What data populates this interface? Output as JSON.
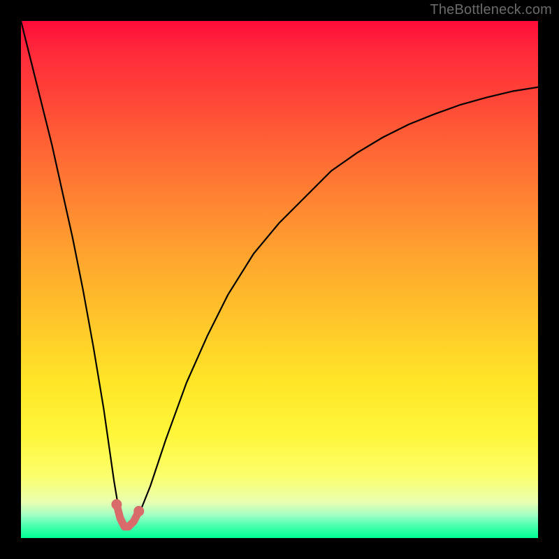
{
  "watermark": "TheBottleneck.com",
  "colors": {
    "frame": "#000000",
    "curve": "#000000",
    "highlight": "#d96b6b"
  },
  "chart_data": {
    "type": "line",
    "title": "",
    "xlabel": "",
    "ylabel": "",
    "xlim": [
      0,
      100
    ],
    "ylim": [
      0,
      100
    ],
    "grid": false,
    "legend": false,
    "description": "Bottleneck-style V-curve: value drops sharply to near zero around x≈20 then rises asymptotically toward the top-right. Background encodes value via gradient (red high → green low). A short pink/red arc highlights the minimum.",
    "series": [
      {
        "name": "bottleneck-curve",
        "x": [
          0,
          2,
          4,
          6,
          8,
          10,
          12,
          14,
          16,
          18,
          19,
          20,
          21,
          22,
          23,
          25,
          28,
          32,
          36,
          40,
          45,
          50,
          55,
          60,
          65,
          70,
          75,
          80,
          85,
          90,
          95,
          100
        ],
        "values": [
          100,
          92,
          84,
          76,
          67,
          58,
          48,
          37,
          25,
          11,
          5,
          2,
          2,
          3,
          5,
          10,
          19,
          30,
          39,
          47,
          55,
          61,
          66,
          71,
          74.5,
          77.5,
          80,
          82,
          83.8,
          85.2,
          86.4,
          87.2
        ]
      },
      {
        "name": "min-highlight",
        "x": [
          18.5,
          19.2,
          20.0,
          20.8,
          21.8,
          22.8
        ],
        "values": [
          6.5,
          3.8,
          2.2,
          2.2,
          3.2,
          5.2
        ]
      }
    ]
  }
}
